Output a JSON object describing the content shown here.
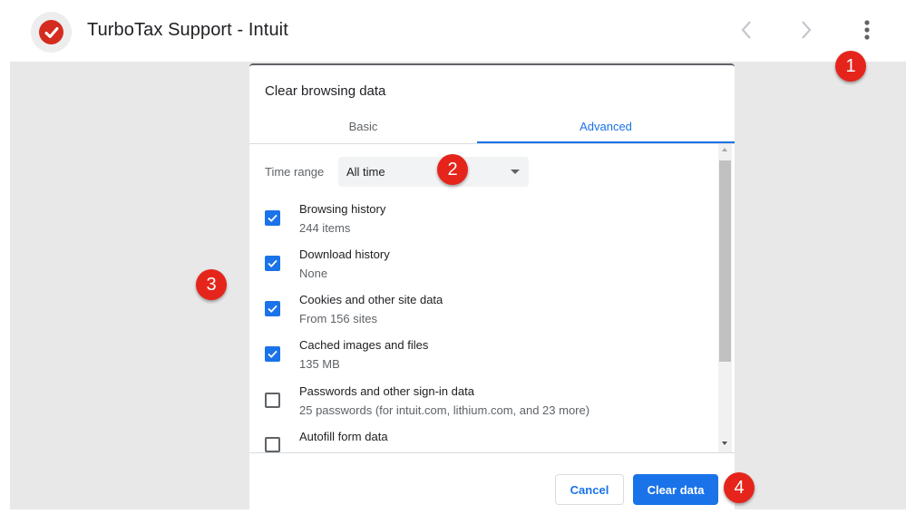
{
  "header": {
    "title": "TurboTax Support - Intuit",
    "logo_icon": "turbotax-check-icon",
    "back_icon": "chevron-left-icon",
    "forward_icon": "chevron-right-icon",
    "menu_icon": "more-vert-icon"
  },
  "dialog": {
    "title": "Clear browsing data",
    "tabs": [
      {
        "label": "Basic",
        "active": false
      },
      {
        "label": "Advanced",
        "active": true
      }
    ],
    "time_range": {
      "label": "Time range",
      "value": "All time"
    },
    "items": [
      {
        "label": "Browsing history",
        "sub": "244 items",
        "checked": true
      },
      {
        "label": "Download history",
        "sub": "None",
        "checked": true
      },
      {
        "label": "Cookies and other site data",
        "sub": "From 156 sites",
        "checked": true
      },
      {
        "label": "Cached images and files",
        "sub": "135 MB",
        "checked": true
      },
      {
        "label": "Passwords and other sign-in data",
        "sub": "25 passwords (for intuit.com, lithium.com, and 23 more)",
        "checked": false
      },
      {
        "label": "Autofill form data",
        "sub": "",
        "checked": false
      }
    ],
    "buttons": {
      "cancel": "Cancel",
      "clear": "Clear data"
    }
  },
  "annotations": [
    "1",
    "2",
    "3",
    "4"
  ],
  "colors": {
    "accent": "#1a73e8",
    "badge": "#e5251b",
    "logo": "#d52b1e"
  }
}
